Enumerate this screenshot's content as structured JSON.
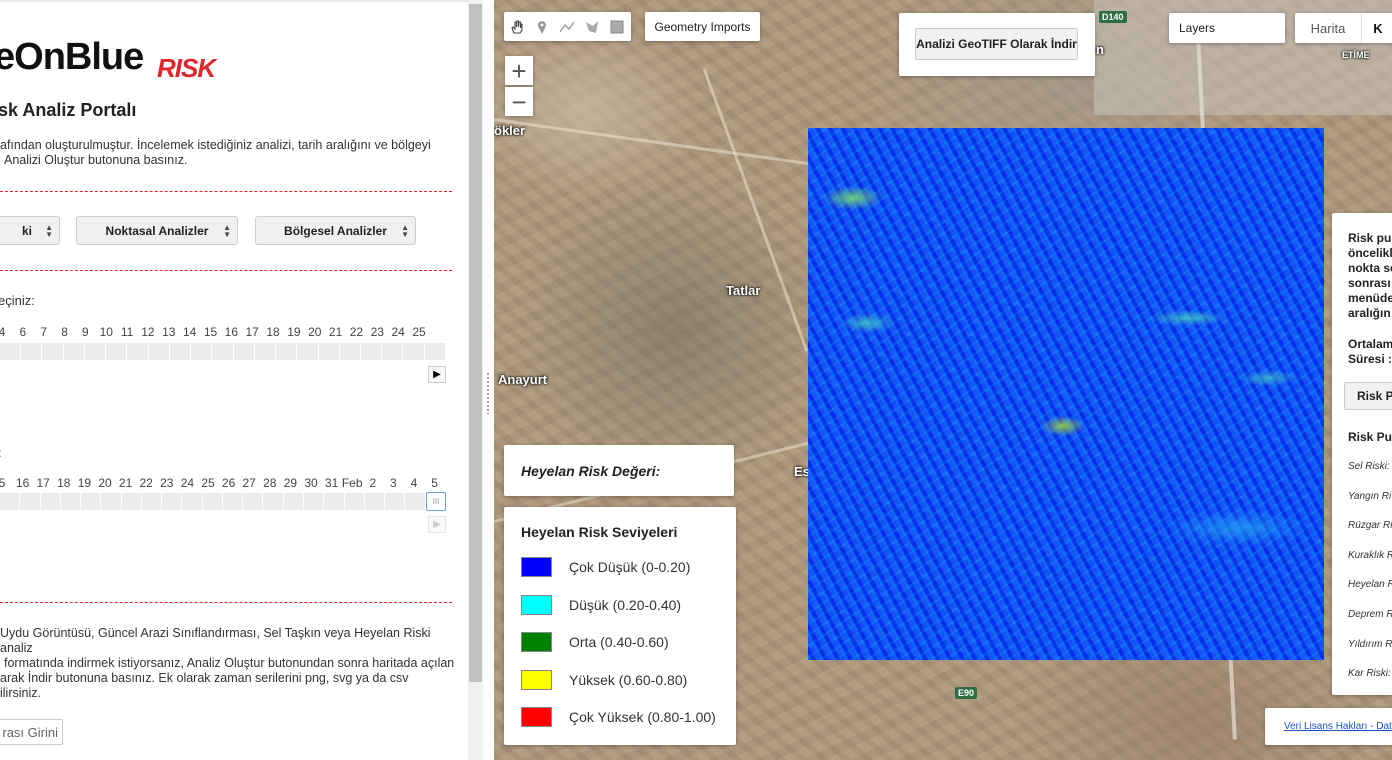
{
  "left": {
    "logo_text": "eOnBlue",
    "logo_risk": "RISK",
    "portal_title": "sk Analiz Portalı",
    "intro_line1": "afından oluşturulmuştur. İncelemek istediğiniz analizi, tarih aralığını ve bölgeyi",
    "intro_line2": "Analizi Oluştur butonuna basınız.",
    "select1": "ki",
    "select2": "Noktasal Analizler",
    "select3": "Bölgesel Analizler",
    "slider1_label": "eçiniz:",
    "slider1_ticks": [
      "4",
      "6",
      "7",
      "8",
      "9",
      "10",
      "11",
      "12",
      "13",
      "14",
      "15",
      "16",
      "17",
      "18",
      "19",
      "20",
      "21",
      "22",
      "23",
      "24",
      "25"
    ],
    "slider2_label": ":",
    "slider2_ticks": [
      "5",
      "16",
      "17",
      "18",
      "19",
      "20",
      "21",
      "22",
      "23",
      "24",
      "25",
      "26",
      "27",
      "28",
      "29",
      "30",
      "31",
      "Feb",
      "2",
      "3",
      "4",
      "5"
    ],
    "handle_glyph": "III",
    "play_glyph": "▶",
    "bottom_line1": "Uydu Görüntüsü, Güncel Arazi Sınıflandırması, Sel Taşkın veya Heyelan Riski analiz",
    "bottom_line2": "formatında indirmek istiyorsanız, Analiz Oluştur butonundan sonra haritada açılan",
    "bottom_line3": "arak İndir butonuna basınız. Ek olarak zaman serilerini png, svg ya da csv",
    "bottom_line4": "ilirsiniz.",
    "input_button": "rası Girini"
  },
  "map": {
    "geometry_imports": "Geometry Imports",
    "download_button": "Analizi GeoTIFF Olarak İndir",
    "layers": "Layers",
    "maptype_map": "Harita",
    "maptype_sat": "K",
    "zoom_in": "+",
    "zoom_out": "−",
    "labels": {
      "okler": "ökler",
      "tatlar": "Tatlar",
      "anayurt": "Anayurt",
      "es": "Es",
      "n": "n",
      "etime": "ETİME"
    },
    "shields": {
      "d140": "D140",
      "e90": "E90"
    },
    "risk_value_label": "Heyelan Risk Değeri:",
    "legend": {
      "title": "Heyelan Risk Seviyeleri",
      "items": [
        {
          "label": "Çok Düşük (0-0.20)",
          "color": "#0000ff"
        },
        {
          "label": "Düşük (0.20-0.40)",
          "color": "#00ffff"
        },
        {
          "label": "Orta (0.40-0.60)",
          "color": "#008000"
        },
        {
          "label": "Yüksek (0.60-0.80)",
          "color": "#ffff00"
        },
        {
          "label": "Çok Yüksek (0.80-1.00)",
          "color": "#ff0000"
        }
      ]
    },
    "right_panel": {
      "p1": "Risk pu",
      "p2": "öncelikl",
      "p3": "nokta se",
      "p4": "sonrası",
      "p5": "menüde",
      "p6": "aralığın",
      "avg1": "Ortalam",
      "avg2": "Süresi :",
      "btn": "Risk P",
      "heading": "Risk Pu",
      "items": [
        "Sel Riski:",
        "Yangın Ri",
        "Rüzgar Ri",
        "Kuraklık R",
        "Heyelan R",
        "Deprem R",
        "Yıldırım R",
        "Kar Riski:"
      ]
    },
    "license_link": "Veri Lisans Hakları - Dat"
  }
}
